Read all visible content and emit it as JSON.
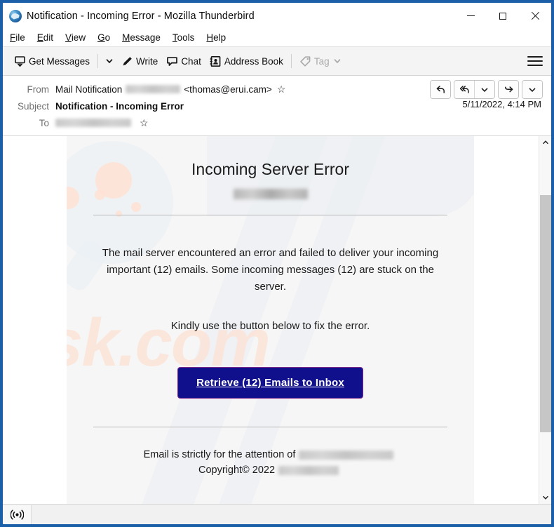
{
  "window": {
    "title": "Notification - Incoming Error - Mozilla Thunderbird",
    "app_icon": "thunderbird-logo-icon",
    "controls": {
      "minimize": "minimize-icon",
      "maximize": "maximize-icon",
      "close": "close-icon"
    }
  },
  "menu": {
    "items": [
      {
        "pre": "",
        "key": "F",
        "post": "ile"
      },
      {
        "pre": "",
        "key": "E",
        "post": "dit"
      },
      {
        "pre": "",
        "key": "V",
        "post": "iew"
      },
      {
        "pre": "",
        "key": "G",
        "post": "o"
      },
      {
        "pre": "",
        "key": "M",
        "post": "essage"
      },
      {
        "pre": "",
        "key": "T",
        "post": "ools"
      },
      {
        "pre": "",
        "key": "H",
        "post": "elp"
      }
    ]
  },
  "toolbar": {
    "get_messages": "Get Messages",
    "write": "Write",
    "chat": "Chat",
    "address_book": "Address Book",
    "tag": "Tag",
    "tag_disabled": true,
    "app_menu": "hamburger-menu-icon"
  },
  "message_header": {
    "from_label": "From",
    "from_name": "Mail Notification",
    "from_address": "<thomas@erui.cam>",
    "from_redacted": true,
    "subject_label": "Subject",
    "subject": "Notification - Incoming Error",
    "to_label": "To",
    "to_redacted": true,
    "date": "5/11/2022, 4:14 PM",
    "actions": {
      "reply": "reply-icon",
      "reply_all": "reply-all-icon",
      "reply_all_more": "chevron-down-icon",
      "forward": "forward-icon",
      "more": "chevron-down-icon"
    }
  },
  "email": {
    "title": "Incoming Server Error",
    "domain_redacted": true,
    "paragraph_1": "The mail server encountered an error and failed to deliver your incoming important (12) emails. Some incoming messages (12) are stuck on the server.",
    "paragraph_2": "Kindly use the button below to fix the error.",
    "cta_label": "Retrieve (12) Emails to Inbox",
    "footer_line_1": "Email is strictly for the attention of",
    "footer_line_2": "Copyright© 2022",
    "footer_redacted": true,
    "watermark_text": "risk.com",
    "colors": {
      "cta_background": "#10108c",
      "cta_border": "#7b2d8e",
      "cta_text": "#ffffff",
      "panel_background": "#f6f6f6",
      "watermark_pink": "#fde4d8",
      "watermark_blue": "#eaeff5",
      "window_border": "#1a5fa8"
    }
  },
  "scrollbar": {
    "up": "chevron-up-icon",
    "down": "chevron-down-icon"
  },
  "status_bar": {
    "icon": "connection-antenna-icon"
  }
}
